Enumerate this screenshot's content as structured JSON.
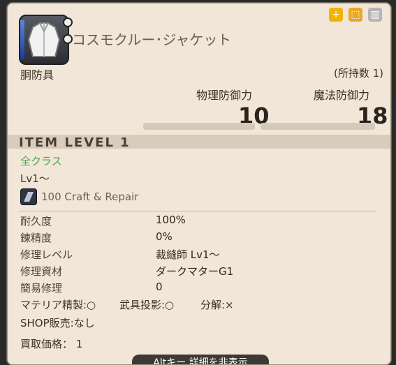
{
  "item": {
    "name": "コスモクルー･ジャケット",
    "slot": "胴防具",
    "owned": "(所持数 1)",
    "item_level": "ITEM LEVEL 1",
    "class": "全クラス",
    "level": "Lv1～",
    "craft_repair": "100 Craft & Repair"
  },
  "stats": {
    "phys_label": "物理防御力",
    "phys_value": "10",
    "mag_label": "魔法防御力",
    "mag_value": "18"
  },
  "details": [
    {
      "label": "耐久度",
      "value": "100%"
    },
    {
      "label": "錬精度",
      "value": "0%"
    },
    {
      "label": "修理レベル",
      "value": "裁縫師 Lv1～"
    },
    {
      "label": "修理資材",
      "value": "ダークマターG1"
    },
    {
      "label": "簡易修理",
      "value": "0"
    }
  ],
  "misc": {
    "materia": "マテリア精製:○",
    "projection": "武具投影:○",
    "desynth": "分解:×",
    "shop": "SHOP販売:なし",
    "buy_price": "買取価格： 1"
  },
  "footer": {
    "alt_hint": "Altキー 詳細を非表示"
  },
  "icons": [
    "add-icon",
    "dye-icon",
    "market-icon",
    "armor-icon",
    "craft-icon"
  ]
}
